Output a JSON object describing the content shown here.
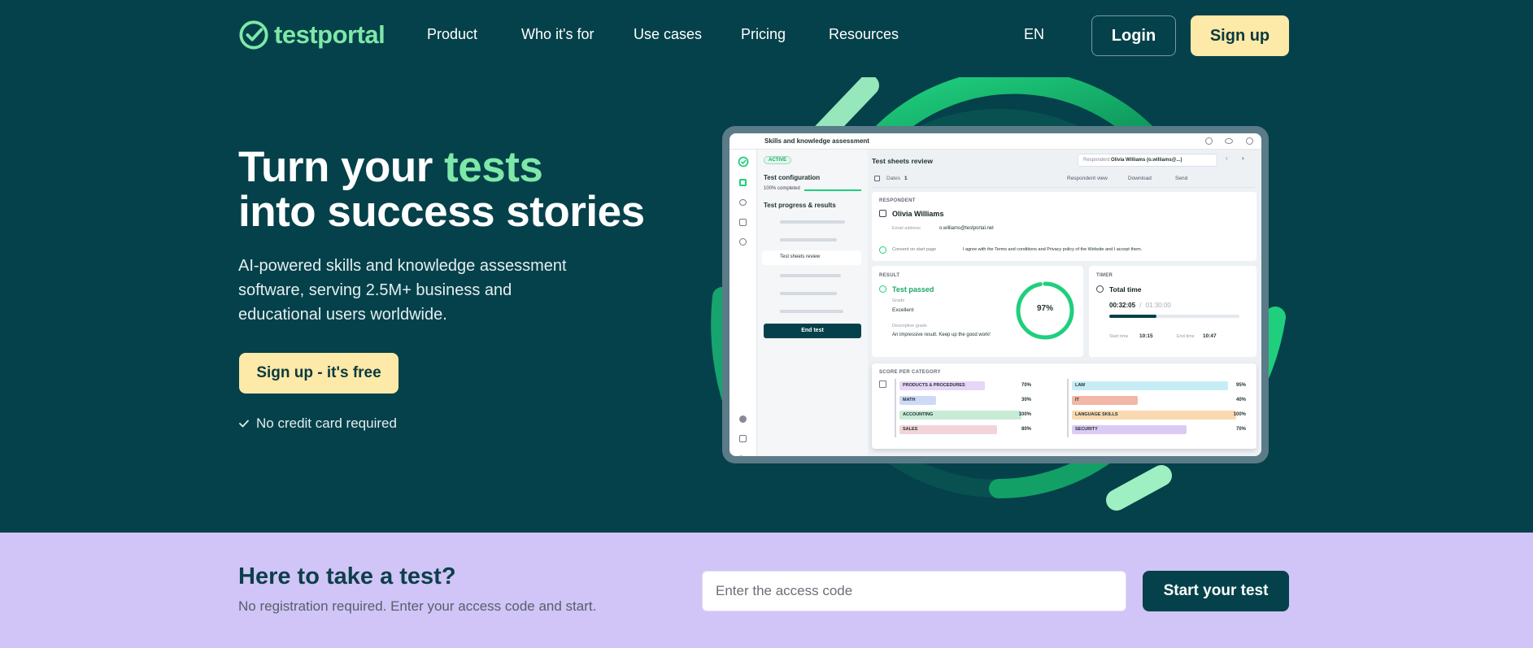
{
  "brand": {
    "name": "testportal"
  },
  "nav": {
    "links": [
      "Product",
      "Who it's for",
      "Use cases",
      "Pricing",
      "Resources"
    ],
    "lang": "EN",
    "login": "Login",
    "signup": "Sign up"
  },
  "hero": {
    "title_part1": "Turn your ",
    "title_accent": "tests",
    "title_part2": "into success stories",
    "subtitle": "AI-powered skills and knowledge assessment software, serving 2.5M+ business and educational users worldwide.",
    "cta": "Sign up - it's free",
    "note": "No credit card required"
  },
  "mockup": {
    "window_title": "Skills and knowledge assessment",
    "status": "ACTIVE",
    "config_title": "Test configuration",
    "config_progress": "100% completed",
    "progress_title": "Test progress & results",
    "active_item": "Test sheets review",
    "end_test": "End test",
    "main_title": "Test sheets review",
    "respondent_label": "Respondent",
    "respondent_value": "Olivia Williams (o.williams@...)",
    "dates_label": "Dates",
    "dates_count": "1",
    "respondent_view": "Respondent view",
    "download": "Download",
    "send": "Send",
    "respondent_section": "RESPONDENT",
    "respondent_name": "Olivia Williams",
    "email_label": "Email address",
    "email_value": "o.williams@testportal.net",
    "consent_label": "Consent on start page",
    "consent_value": "I agree with the Terms and conditions and Privacy policy of the Website and I accept them.",
    "result_section": "RESULT",
    "result_status": "Test passed",
    "grade_label": "Grade",
    "grade_value": "Excellent",
    "desc_grade_label": "Descriptive grade",
    "desc_grade_value": "An impressive result. Keep up the good work!",
    "score": "97%",
    "score_value": 0.97,
    "timer_section": "TIMER",
    "total_time_label": "Total time",
    "time_used": "00:32:05",
    "time_sep": "/",
    "time_limit": "01:30:00",
    "time_progress": 0.36,
    "start_label": "Start time",
    "start_value": "10:15",
    "end_label": "End time",
    "end_value": "10:47",
    "category_section": "SCORE PER CATEGORY",
    "categories_left": [
      {
        "name": "PRODUCTS & PROCEDURES",
        "value": "70%",
        "pct": 0.7,
        "color": "#e7d6f7"
      },
      {
        "name": "MATH",
        "value": "30%",
        "pct": 0.3,
        "color": "#cdd9f7"
      },
      {
        "name": "ACCOUNTING",
        "value": "100%",
        "pct": 1.0,
        "color": "#c7ebd5"
      },
      {
        "name": "SALES",
        "value": "80%",
        "pct": 0.8,
        "color": "#f2d4d8"
      }
    ],
    "categories_right": [
      {
        "name": "LAW",
        "value": "95%",
        "pct": 0.95,
        "color": "#c6ecf6"
      },
      {
        "name": "IT",
        "value": "40%",
        "pct": 0.4,
        "color": "#f2b7a6"
      },
      {
        "name": "LANGUAGE SKILLS",
        "value": "100%",
        "pct": 1.0,
        "color": "#f9d9b0"
      },
      {
        "name": "SECURITY",
        "value": "70%",
        "pct": 0.7,
        "color": "#dccaf6"
      }
    ]
  },
  "band": {
    "title": "Here to take a test?",
    "subtitle": "No registration required. Enter your access code and start.",
    "placeholder": "Enter the access code",
    "button": "Start your test"
  }
}
